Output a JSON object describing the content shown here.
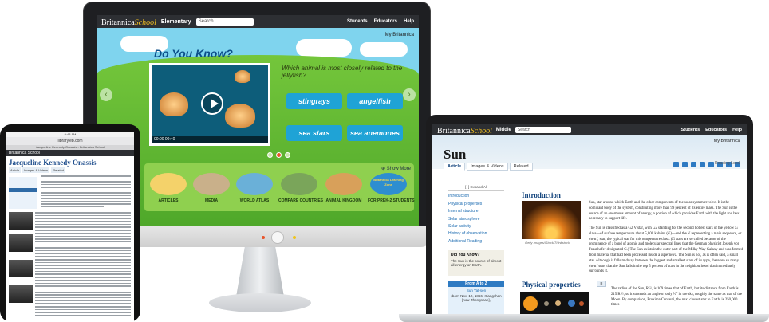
{
  "desktop": {
    "brand": "Britannica",
    "brand_school": "School",
    "edition": "Elementary",
    "search_placeholder": "Search",
    "nav": [
      "Students",
      "Educators",
      "Help"
    ],
    "my_britannica": "My Britannica",
    "heading": "Do You Know?",
    "question": "Which animal is most closely related to the jellyfish?",
    "answers": [
      "stingrays",
      "angelfish",
      "sea stars",
      "sea anemones"
    ],
    "video_time": "00:00 00:40",
    "show_more": "Show More",
    "categories": [
      {
        "label": "ARTICLES",
        "color": "#f4d26a"
      },
      {
        "label": "MEDIA",
        "color": "#c9b08a"
      },
      {
        "label": "WORLD ATLAS",
        "color": "#6ab0d8"
      },
      {
        "label": "COMPARE COUNTRIES",
        "color": "#7aa55a"
      },
      {
        "label": "ANIMAL KINGDOM",
        "color": "#d8a05a"
      },
      {
        "label": "FOR PREK-2 STUDENTS",
        "color": "#2e8ed0",
        "badge": "Britannica Learning Zone"
      }
    ]
  },
  "tablet": {
    "status": "9:43 AM",
    "url": "library.eb.com",
    "tab": "Jacqueline Kennedy Onassis - Britannica School",
    "brand": "Britannica School",
    "title": "Jacqueline Kennedy Onassis",
    "tabs": [
      "Article",
      "Images & Videos",
      "Related"
    ]
  },
  "laptop": {
    "brand": "Britannica",
    "brand_school": "School",
    "edition": "Middle",
    "search_placeholder": "Search",
    "nav": [
      "Students",
      "Educators",
      "Help"
    ],
    "my_britannica": "My Britannica",
    "title": "Sun",
    "tabs": [
      "Article",
      "Images & Videos",
      "Related"
    ],
    "reading_level": "Reading Level",
    "sidebar": {
      "expand": "[+] Expand All",
      "items": [
        "Introduction",
        "Physical properties",
        "Internal structure",
        "Solar atmosphere",
        "Solar activity",
        "History of observation",
        "Additional Reading"
      ]
    },
    "did_you_know": {
      "title": "Did You Know?",
      "text": "The Sun is the source of almost all energy on Earth."
    },
    "a_to_z": {
      "title": "From A to Z",
      "name": "Sun Yat-sen",
      "detail": "(born Nov. 12, 1866, Xiangshan [now Zhongshan],"
    },
    "image_caption": "Getty Images/iStock/Thinkstock",
    "intro_heading": "Introduction",
    "intro_p1": "Sun, star around which Earth and the other components of the solar system revolve. It is the dominant body of the system, constituting more than 99 percent of its entire mass. The Sun is the source of an enormous amount of energy, a portion of which provides Earth with the light and heat necessary to support life.",
    "intro_p2": "The Sun is classified as a G2 V star, with G2 standing for the second hottest stars of the yellow G class—of surface temperature about 5,800 kelvins (K)—and the V representing a main sequence, or dwarf, star, the typical star for this temperature class. (G stars are so called because of the prominence of a band of atomic and molecular spectral lines that the German physicist Joseph von Fraunhofer designated G.) The Sun exists in the outer part of the Milky Way Galaxy and was formed from material that had been processed inside a supernova. The Sun is not, as is often said, a small star. Although it falls midway between the biggest and smallest stars of its type, there are so many dwarf stars that the Sun falls in the top 5 percent of stars in the neighbourhood that immediately surrounds it.",
    "phys_heading": "Physical properties",
    "phys_p1": "The radius of the Sun, R☉, is 109 times that of Earth, but its distance from Earth is 215 R☉, so it subtends an angle of only ½° in the sky, roughly the same as that of the Moon. By comparison, Proxima Centauri, the next closest star to Earth, is 250,000 times"
  }
}
